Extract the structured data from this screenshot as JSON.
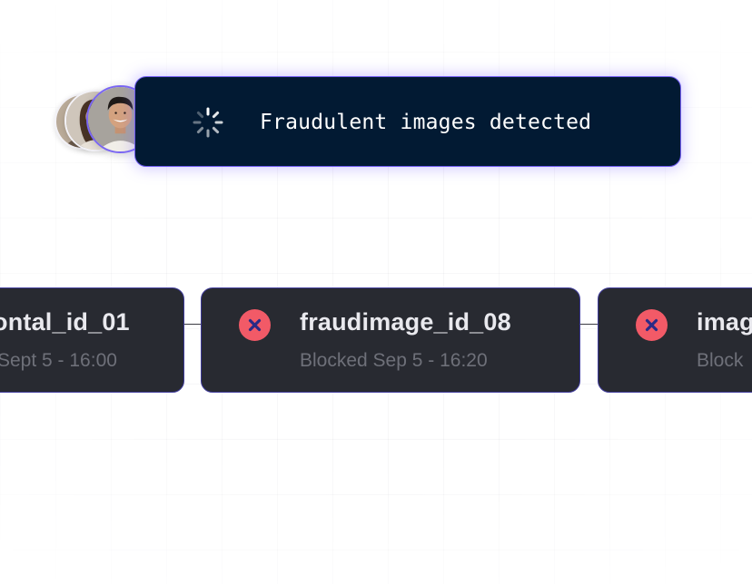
{
  "notification": {
    "message": "Fraudulent images detected",
    "spinner_icon": "loading-spinner-icon",
    "avatars": [
      "avatar-person",
      "avatar-person",
      "avatar-person"
    ]
  },
  "cards": [
    {
      "title": "ontal_id_01",
      "subtitle": "Sept 5 - 16:00",
      "status": "",
      "icon": ""
    },
    {
      "title": "fraudimage_id_08",
      "subtitle": "Blocked Sep 5 - 16:20",
      "status": "blocked",
      "icon": "x-icon"
    },
    {
      "title": "imag",
      "subtitle": "Block",
      "status": "blocked",
      "icon": "x-icon"
    }
  ],
  "colors": {
    "banner_bg": "#021a33",
    "banner_border": "#6f5cf0",
    "card_bg": "#282a31",
    "card_border": "#3e3a9a",
    "blocked_badge": "#f25a67",
    "blocked_mark": "#2b2a86"
  }
}
